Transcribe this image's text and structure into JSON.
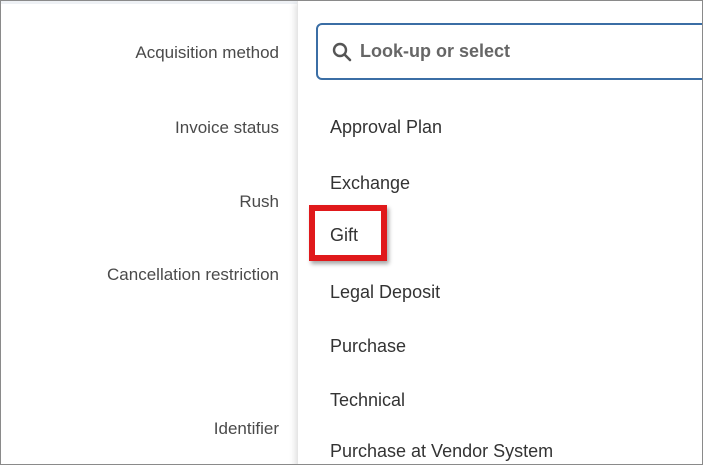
{
  "form": {
    "labels": {
      "acquisition_method": "Acquisition method",
      "invoice_status": "Invoice status",
      "rush": "Rush",
      "cancellation_restriction": "Cancellation restriction",
      "identifier": "Identifier"
    }
  },
  "dropdown": {
    "search": {
      "placeholder": "Look-up or select",
      "value": ""
    },
    "options": [
      "Approval Plan",
      "Exchange",
      "Gift",
      "Legal Deposit",
      "Purchase",
      "Technical",
      "Purchase at Vendor System"
    ],
    "highlighted_option": "Gift"
  },
  "colors": {
    "highlight": "#e0191b",
    "search_border": "#3b6ea5",
    "label_text": "#4a4a4a",
    "option_text": "#333333"
  }
}
